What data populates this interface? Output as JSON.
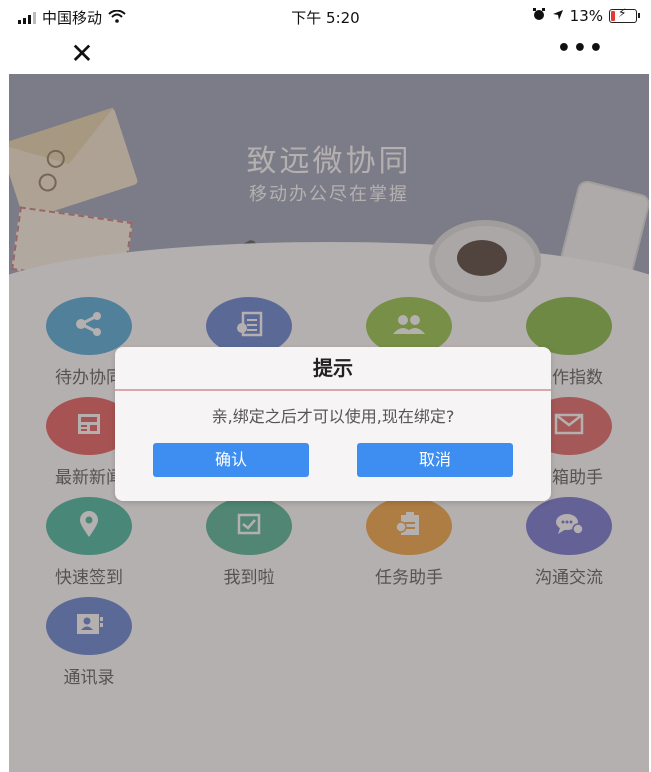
{
  "status_bar": {
    "carrier": "中国移动",
    "time": "下午 5:20",
    "battery_percent": "13%"
  },
  "nav": {
    "close_icon": "close-icon",
    "more_label": "•••"
  },
  "banner": {
    "title": "致远微协同",
    "subtitle": "移动办公尽在掌握"
  },
  "apps": [
    {
      "label": "待办协同",
      "color": "#4aa8d8",
      "icon": "share-nodes-icon"
    },
    {
      "label": "",
      "color": "#5b7fd2",
      "icon": "document-list-icon"
    },
    {
      "label": "",
      "color": "#8fc33f",
      "icon": "people-icon"
    },
    {
      "label": "工作指数",
      "color": "#7fb83a",
      "icon": "chart-icon"
    },
    {
      "label": "最新新闻",
      "color": "#e55656",
      "icon": "news-icon"
    },
    {
      "label": "",
      "color": "#a0a0a0",
      "icon": ""
    },
    {
      "label": "",
      "color": "#a0a0a0",
      "icon": ""
    },
    {
      "label": "邮箱助手",
      "color": "#e06060",
      "icon": "mail-icon"
    },
    {
      "label": "快速签到",
      "color": "#3bb59a",
      "icon": "location-pin-icon"
    },
    {
      "label": "我到啦",
      "color": "#47b290",
      "icon": "checkbox-icon"
    },
    {
      "label": "任务助手",
      "color": "#f0a23a",
      "icon": "clipboard-icon"
    },
    {
      "label": "沟通交流",
      "color": "#6a6fd0",
      "icon": "chat-bubble-icon"
    },
    {
      "label": "通讯录",
      "color": "#5a7fcf",
      "icon": "contact-card-icon"
    }
  ],
  "dialog": {
    "title": "提示",
    "message": "亲,绑定之后才可以使用,现在绑定?",
    "confirm_label": "确认",
    "cancel_label": "取消"
  }
}
